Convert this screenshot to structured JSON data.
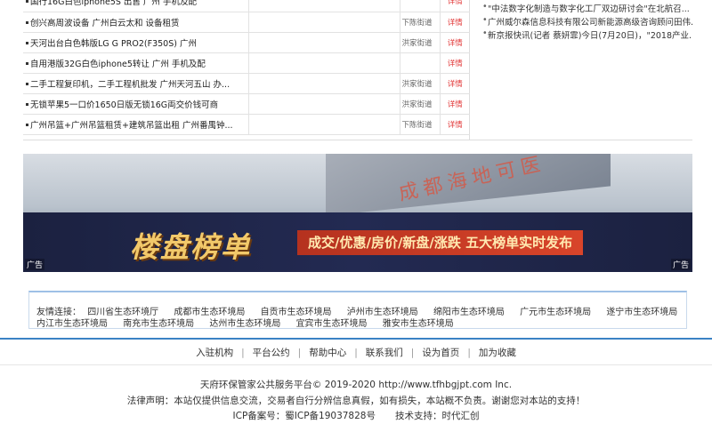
{
  "listings": [
    {
      "title": "国行16G白色iphone5S 出售 广州 手机及配",
      "area": "",
      "detail": "详情"
    },
    {
      "title": "创兴高周波设备 广州白云太和 设备租赁",
      "area": "下陈街道",
      "detail": "详情"
    },
    {
      "title": "天河出台白色韩版LG G PRO2(F350S) 广州",
      "area": "洪家街道",
      "detail": "详情"
    },
    {
      "title": "自用港版32G白色iphone5转让 广州 手机及配",
      "area": "",
      "detail": "详情"
    },
    {
      "title": "二手工程复印机，二手工程机批发 广州天河五山 办...",
      "area": "洪家街道",
      "detail": "详情"
    },
    {
      "title": "无锁苹果5一口价1650日版无锁16G両交价钱可商",
      "area": "洪家街道",
      "detail": "详情"
    },
    {
      "title": "广州吊篮+广州吊篮租赁+建筑吊篮出租 广州番禺钟...",
      "area": "下陈街道",
      "detail": "详情"
    }
  ],
  "news": [
    "\"中法数字化制造与数字化工厂双边研讨会\"在北航召...",
    "广州威尔森信息科技有限公司新能源高级咨询顾问田伟...",
    "新京报快讯(记者 蔡妍霏)今日(7月20日)，\"2018产业..."
  ],
  "banner": {
    "building_text": "成都海地可医",
    "big_text": "楼盘榜单",
    "slogan": "成交/优惠/房价/新盘/涨跌 五大榜单实时发布",
    "ad_left": "广告",
    "ad_right": "广告"
  },
  "friend_links": {
    "label": "友情连接：",
    "row1": [
      "四川省生态环境厅",
      "成都市生态环境局",
      "自贡市生态环境局",
      "泸州市生态环境局",
      "绵阳市生态环境局",
      "广元市生态环境局",
      "遂宁市生态环境局"
    ],
    "row2": [
      "内江市生态环境局",
      "南充市生态环境局",
      "达州市生态环境局",
      "宜宾市生态环境局",
      "雅安市生态环境局"
    ]
  },
  "footer": {
    "nav": [
      "入驻机构",
      "平台公约",
      "帮助中心",
      "联系我们",
      "设为首页",
      "加为收藏"
    ],
    "copyright": "天府环保管家公共服务平台© 2019-2020 http://www.tfhbgjpt.com Inc.",
    "legal": "法律声明：本站仅提供信息交流，交易者自行分辨信息真假，如有损失，本站概不负责。谢谢您对本站的支持！",
    "icp": "ICP备案号：蜀ICP备19037828号",
    "tech": "技术支持：时代汇创"
  },
  "colors": {
    "accent_blue": "#3b82c4",
    "detail_red": "#e23a3a",
    "banner_gold": "#f2c96a"
  }
}
